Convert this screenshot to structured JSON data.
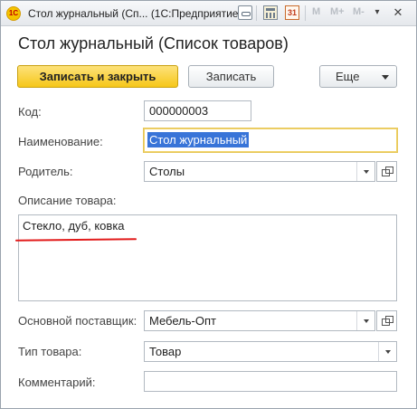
{
  "window": {
    "logo_text": "1С",
    "title": "Стол журнальный (Сп...   (1С:Предприятие)",
    "calendar_day": "31",
    "memory": [
      "M",
      "M+",
      "M-"
    ],
    "menu_glyph": "▾",
    "close_glyph": "✕"
  },
  "form": {
    "heading": "Стол журнальный (Список товаров)"
  },
  "toolbar": {
    "save_close_label": "Записать и закрыть",
    "save_label": "Записать",
    "more_label": "Еще"
  },
  "fields": {
    "code": {
      "label": "Код:",
      "value": "000000003"
    },
    "name": {
      "label": "Наименование:",
      "value": "Стол журнальный"
    },
    "parent": {
      "label": "Родитель:",
      "value": "Столы"
    },
    "description": {
      "label": "Описание товара:",
      "value": "Стекло, дуб, ковка"
    },
    "supplier": {
      "label": "Основной поставщик:",
      "value": "Мебель-Опт"
    },
    "type": {
      "label": "Тип товара:",
      "value": "Товар"
    },
    "comment": {
      "label": "Комментарий:",
      "value": ""
    }
  },
  "colors": {
    "accent": "#f6c719",
    "annotation": "#e21b1b",
    "selection": "#3874d8"
  }
}
